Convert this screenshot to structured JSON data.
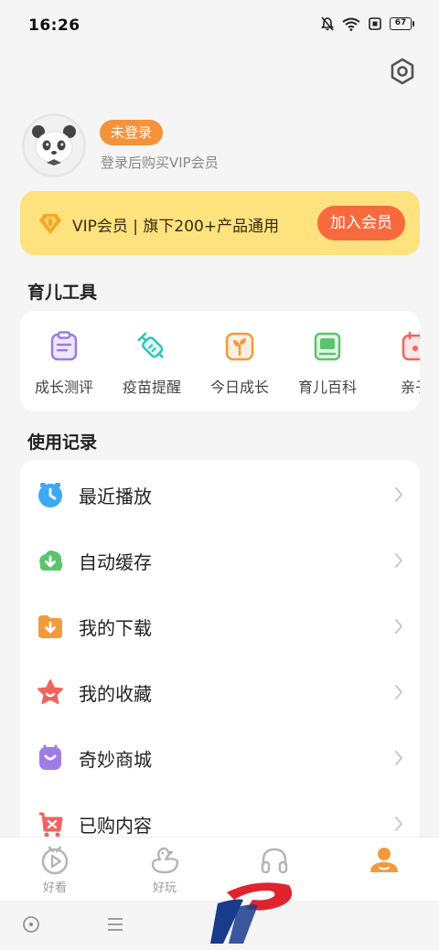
{
  "status_bar": {
    "time": "16:26",
    "battery": "67"
  },
  "profile": {
    "login_badge": "未登录",
    "login_hint": "登录后购买VIP会员"
  },
  "vip": {
    "text": "VIP会员 | 旗下200+产品通用",
    "join_label": "加入会员"
  },
  "tools": {
    "title": "育儿工具",
    "items": [
      {
        "label": "成长测评",
        "icon": "clipboard-icon",
        "color": "#9b7be8"
      },
      {
        "label": "疫苗提醒",
        "icon": "syringe-icon",
        "color": "#2fc4b8"
      },
      {
        "label": "今日成长",
        "icon": "sprout-icon",
        "color": "#f59a3c"
      },
      {
        "label": "育儿百科",
        "icon": "book-icon",
        "color": "#5cc46c"
      },
      {
        "label": "亲子",
        "icon": "calendar-icon",
        "color": "#f0645e"
      }
    ]
  },
  "records": {
    "title": "使用记录",
    "items": [
      {
        "label": "最近播放",
        "icon": "clock-icon",
        "color": "#3fa8f4"
      },
      {
        "label": "自动缓存",
        "icon": "download-cloud-icon",
        "color": "#5cc46c"
      },
      {
        "label": "我的下载",
        "icon": "folder-download-icon",
        "color": "#f59a3c"
      },
      {
        "label": "我的收藏",
        "icon": "star-icon",
        "color": "#f0645e"
      },
      {
        "label": "奇妙商城",
        "icon": "shopping-bag-icon",
        "color": "#a07ce8"
      },
      {
        "label": "已购内容",
        "icon": "purchased-icon",
        "color": "#f0645e"
      }
    ]
  },
  "bottom_nav": {
    "items": [
      {
        "label": "好看",
        "icon": "tv-icon"
      },
      {
        "label": "好玩",
        "icon": "duck-icon"
      },
      {
        "label": "",
        "icon": "headphones-icon"
      },
      {
        "label": "",
        "icon": "profile-icon",
        "active": true
      }
    ],
    "active_color": "#f59a3c",
    "inactive_color": "#b5b5b5"
  },
  "colors": {
    "accent_orange": "#f5933a",
    "vip_bg": "#fde27e",
    "join_button": "#f86a3d"
  }
}
